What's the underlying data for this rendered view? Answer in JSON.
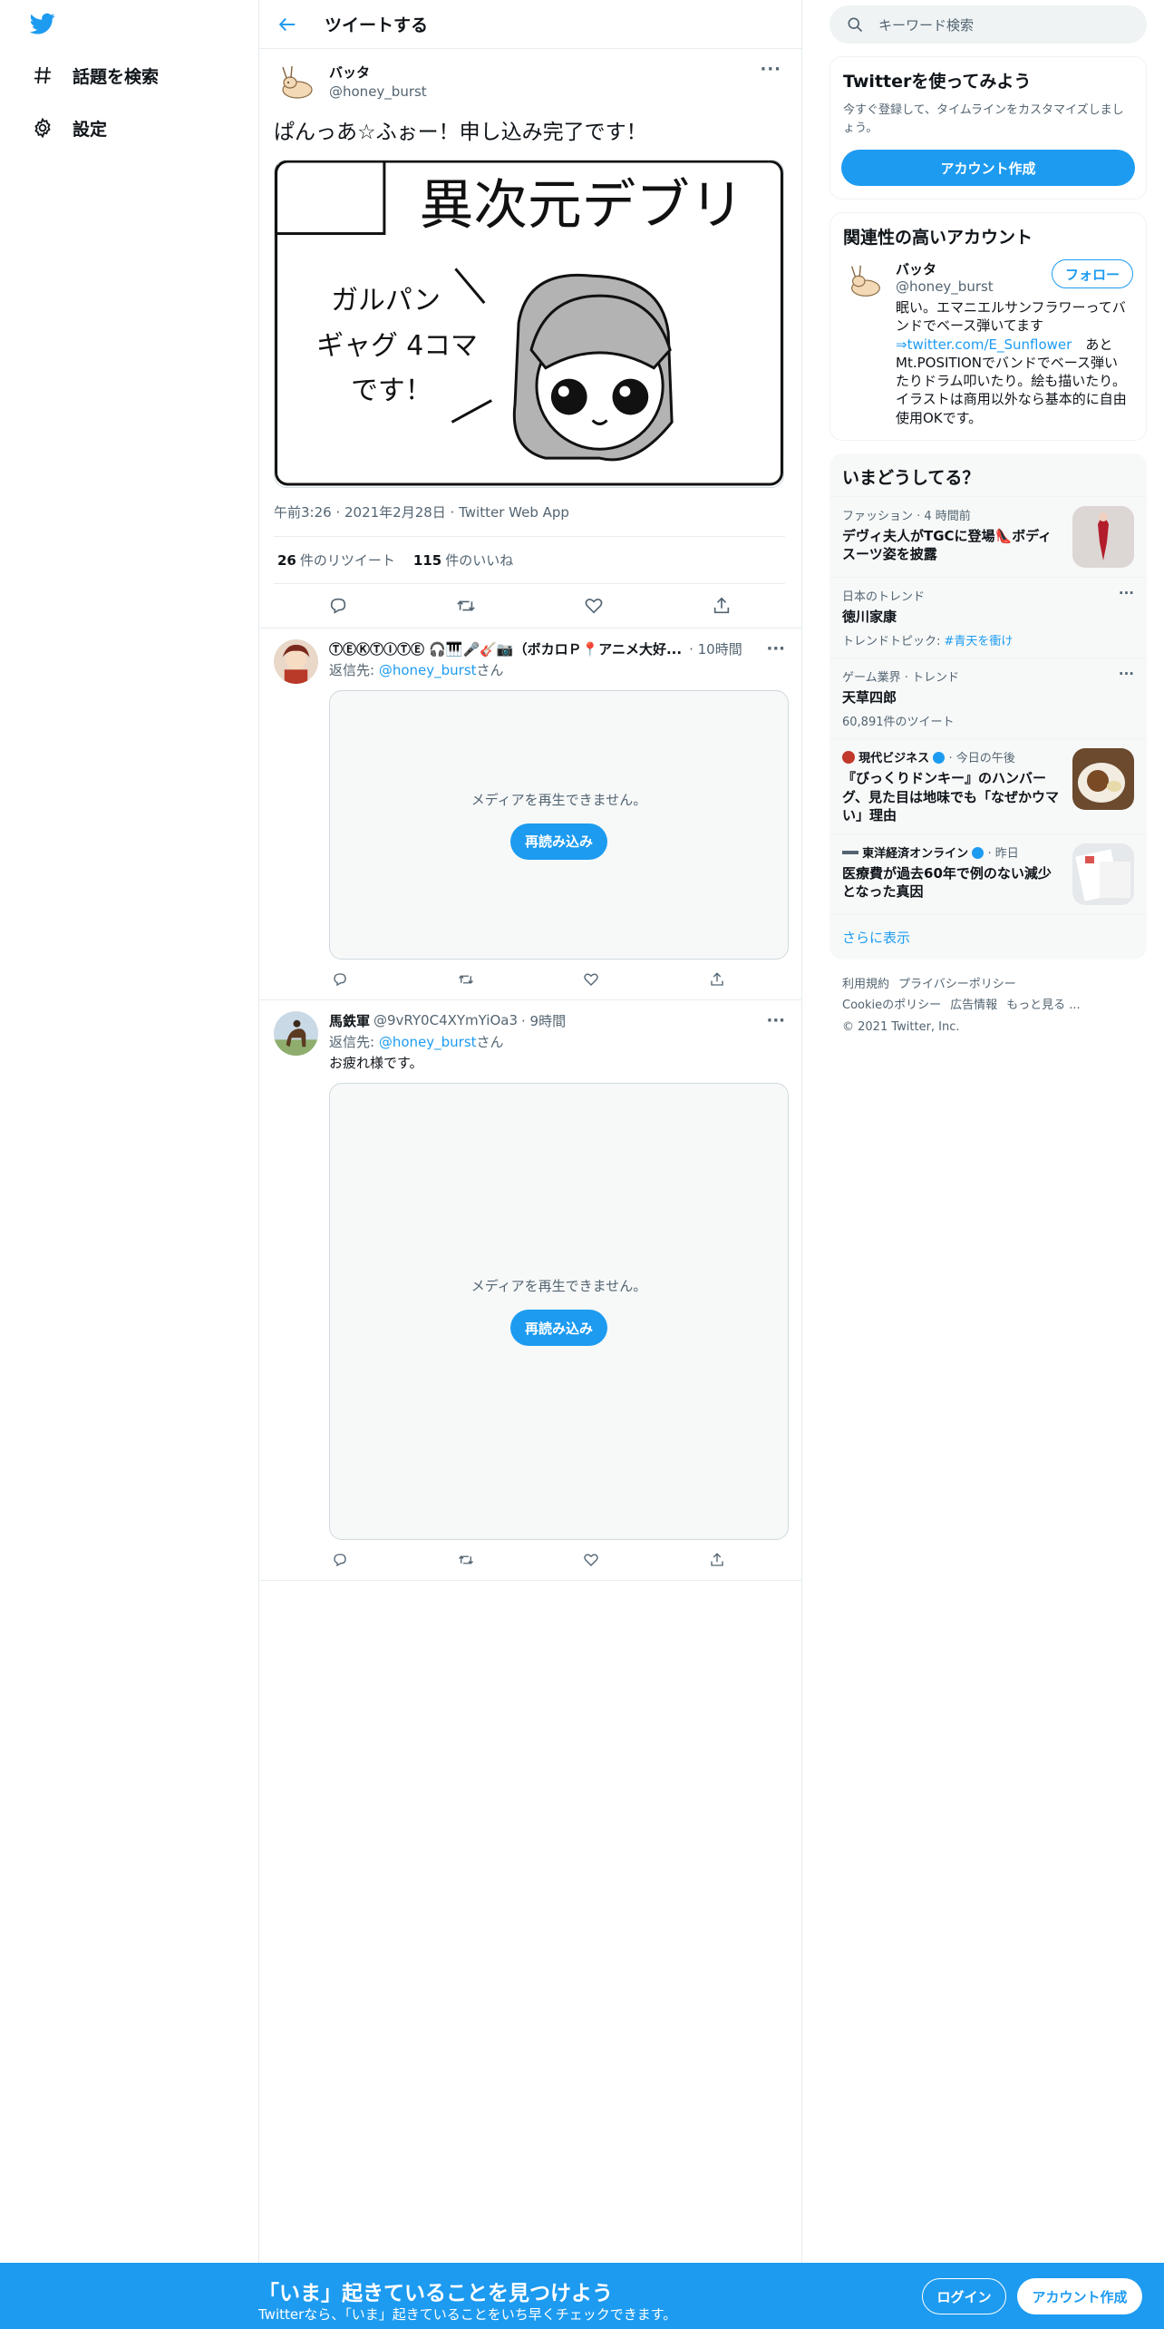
{
  "nav": {
    "explore_label": "話題を検索",
    "settings_label": "設定"
  },
  "header": {
    "title": "ツイートする"
  },
  "main_tweet": {
    "author_name": "バッタ",
    "author_handle": "@honey_burst",
    "text": "ぱんっあ☆ふぉー！申し込み完了です！",
    "image_text": {
      "title": "異次元デブリ",
      "line1": "ガルパン",
      "line2": "ギャグ 4コマ",
      "line3": "です！"
    },
    "timestamp": "午前3:26 · 2021年2月28日 · Twitter Web App",
    "retweet_count": "26",
    "retweet_label": "件のリツイート",
    "like_count": "115",
    "like_label": "件のいいね"
  },
  "replies": [
    {
      "name": "ⓉⒺⓀⓉⒾⓉⒺ 🎧🎹🎤🎸📷（ボカロＰ📍アニメ大好...",
      "handle": "",
      "time": "· 10時間",
      "reply_to_prefix": "返信先: ",
      "reply_to_handle": "@honey_burst",
      "reply_to_suffix": "さん",
      "text": "",
      "media_message": "メディアを再生できません。",
      "reload_label": "再読み込み"
    },
    {
      "name": "馬鉄軍",
      "handle": "@9vRY0C4XYmYiOa3",
      "time": "· 9時間",
      "reply_to_prefix": "返信先: ",
      "reply_to_handle": "@honey_burst",
      "reply_to_suffix": "さん",
      "text": "お疲れ様です。",
      "media_message": "メディアを再生できません。",
      "reload_label": "再読み込み"
    }
  ],
  "search": {
    "placeholder": "キーワード検索"
  },
  "signup_card": {
    "title": "Twitterを使ってみよう",
    "desc": "今すぐ登録して、タイムラインをカスタマイズしましょう。",
    "button": "アカウント作成"
  },
  "related_card": {
    "title": "関連性の高いアカウント",
    "name": "バッタ",
    "handle": "@honey_burst",
    "follow_label": "フォロー",
    "bio_1": "眠い。エマニエルサンフラワーってバンドでベース弾いてます",
    "bio_link": "⇒twitter.com/E_Sunflower",
    "bio_2": "　あとMt.POSITIONでバンドでベース弾いたりドラム叩いたり。絵も描いたり。イラストは商用以外なら基本的に自由使用OKです。"
  },
  "trends": {
    "title": "いまどうしてる？",
    "items": [
      {
        "meta": "ファッション · 4 時間前",
        "title": "デヴィ夫人がTGCに登場👠ボディスーツ姿を披露",
        "sub": ""
      },
      {
        "meta": "日本のトレンド",
        "title": "徳川家康",
        "sub_prefix": "トレンドトピック: ",
        "sub_link": "#青天を衝け"
      },
      {
        "meta": "ゲーム業界 · トレンド",
        "title": "天草四郎",
        "sub": "60,891件のツイート"
      },
      {
        "meta_source": "現代ビジネス",
        "meta": "· 今日の午後",
        "title": "『びっくりドンキー』のハンバーグ、見た目は地味でも「なぜかウマい」理由"
      },
      {
        "meta_source": "東洋経済オンライン",
        "meta": "· 昨日",
        "title": "医療費が過去60年で例のない減少となった真因"
      }
    ],
    "show_more": "さらに表示"
  },
  "footer": {
    "links": [
      "利用規約",
      "プライバシーポリシー",
      "Cookieのポリシー",
      "広告情報",
      "もっと見る ..."
    ],
    "copyright": "© 2021 Twitter, Inc."
  },
  "bottom_bar": {
    "title": "「いま」起きていることを見つけよう",
    "subtitle": "Twitterなら、「いま」起きていることをいち早くチェックできます。",
    "login": "ログイン",
    "signup": "アカウント作成"
  },
  "colors": {
    "brand": "#1d9bf0",
    "text": "#0f1419",
    "secondary": "#536471",
    "border": "#e6ecf0"
  }
}
